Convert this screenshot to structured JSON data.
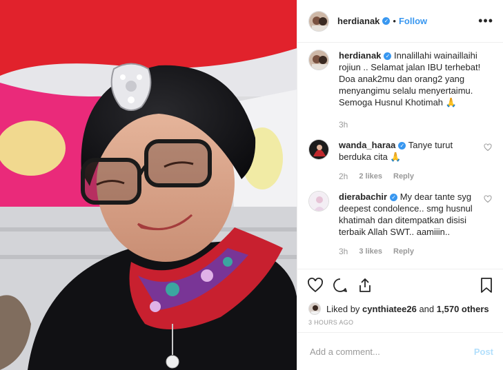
{
  "post": {
    "username": "herdianak",
    "follow_label": "Follow",
    "separator": "•",
    "more_label": "•••"
  },
  "media": {
    "alt": "Photo of a smiling elderly woman wearing a black turban with a jeweled brooch, large glasses and a colorful floral scarf"
  },
  "comments": [
    {
      "username": "herdianak",
      "verified": true,
      "text": "Innalillahi wainaillaihi rojiun .. Selamat jalan IBU terhebat! Doa anak2mu dan orang2 yang menyangimu selalu menyertaimu. Semoga Husnul Khotimah 🙏",
      "time": "3h"
    },
    {
      "username": "wanda_haraa",
      "verified": true,
      "text": "Tanye turut berduka cita 🙏",
      "time": "2h",
      "likes": "2 likes",
      "reply": "Reply"
    },
    {
      "username": "dierabachir",
      "verified": true,
      "text": "My dear tante syg deepest condolence.. smg husnul khatimah dan ditempatkan disisi terbaik Allah SWT.. aamiiin..",
      "time": "3h",
      "likes": "3 likes",
      "reply": "Reply"
    }
  ],
  "liked_by": {
    "prefix": "Liked by",
    "user": "cynthiatee26",
    "and": "and",
    "count": "1,570 others"
  },
  "timestamp": "3 HOURS AGO",
  "add_comment": {
    "placeholder": "Add a comment...",
    "post_label": "Post"
  },
  "colors": {
    "accent": "#3897f0",
    "post_disabled": "#b2dffc",
    "muted": "#999999",
    "text": "#262626"
  }
}
